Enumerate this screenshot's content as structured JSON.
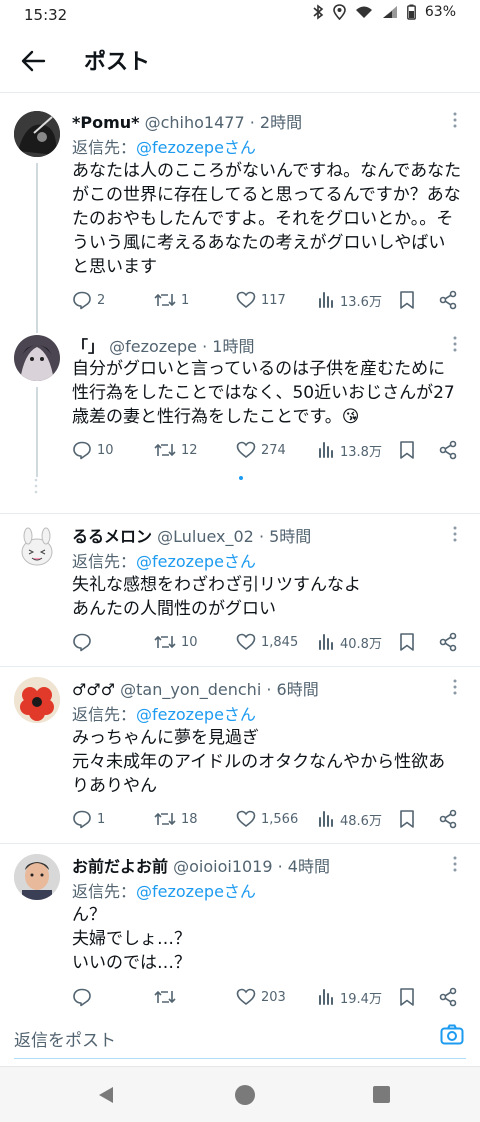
{
  "status": {
    "time": "15:32",
    "battery": "63%"
  },
  "header": {
    "title": "ポスト"
  },
  "reply_prefix": "返信先：",
  "posts": [
    {
      "name": "*Pomu*",
      "handle": "@chiho1477 · 2時間",
      "reply_to": "@fezozepeさん",
      "text": "あなたは人のこころがないんですね。なんであなたがこの世界に存在してると思ってるんですか？あなたのおやもしたんですよ。それをグロいとか。。そういう風に考えるあなたの考えがグロいしやばいと思います",
      "replies": "2",
      "reposts": "1",
      "likes": "117",
      "views": "13.6万"
    },
    {
      "name": "「」",
      "handle": "@fezozepe · 1時間",
      "text": "自分がグロいと言っているのは子供を産むために性行為をしたことではなく、50近いおじさんが27歳差の妻と性行為をしたことです。😘",
      "replies": "10",
      "reposts": "12",
      "likes": "274",
      "views": "13.8万"
    },
    {
      "name": "るるメロン",
      "handle": "@Luluex_02 · 5時間",
      "reply_to": "@fezozepeさん",
      "text": "失礼な感想をわざわざ引リツすんなよ\nあんたの人間性のがグロい",
      "replies": "",
      "reposts": "10",
      "likes": "1,845",
      "views": "40.8万"
    },
    {
      "name": "♂♂♂",
      "handle": "@tan_yon_denchi · 6時間",
      "reply_to": "@fezozepeさん",
      "text": "みっちゃんに夢を見過ぎ\n元々未成年のアイドルのオタクなんやから性欲ありありやん",
      "replies": "1",
      "reposts": "18",
      "likes": "1,566",
      "views": "48.6万"
    },
    {
      "name": "お前だよお前",
      "handle": "@oioioi1019 · 4時間",
      "reply_to": "@fezozepeさん",
      "text": "ん？\n夫婦でしょ…？\nいいのでは…？",
      "replies": "",
      "reposts": "",
      "likes": "203",
      "views": "19.4万"
    }
  ],
  "compose": {
    "placeholder": "返信をポスト"
  },
  "colors": {
    "accent": "#1d9bf0",
    "muted": "#536471"
  }
}
